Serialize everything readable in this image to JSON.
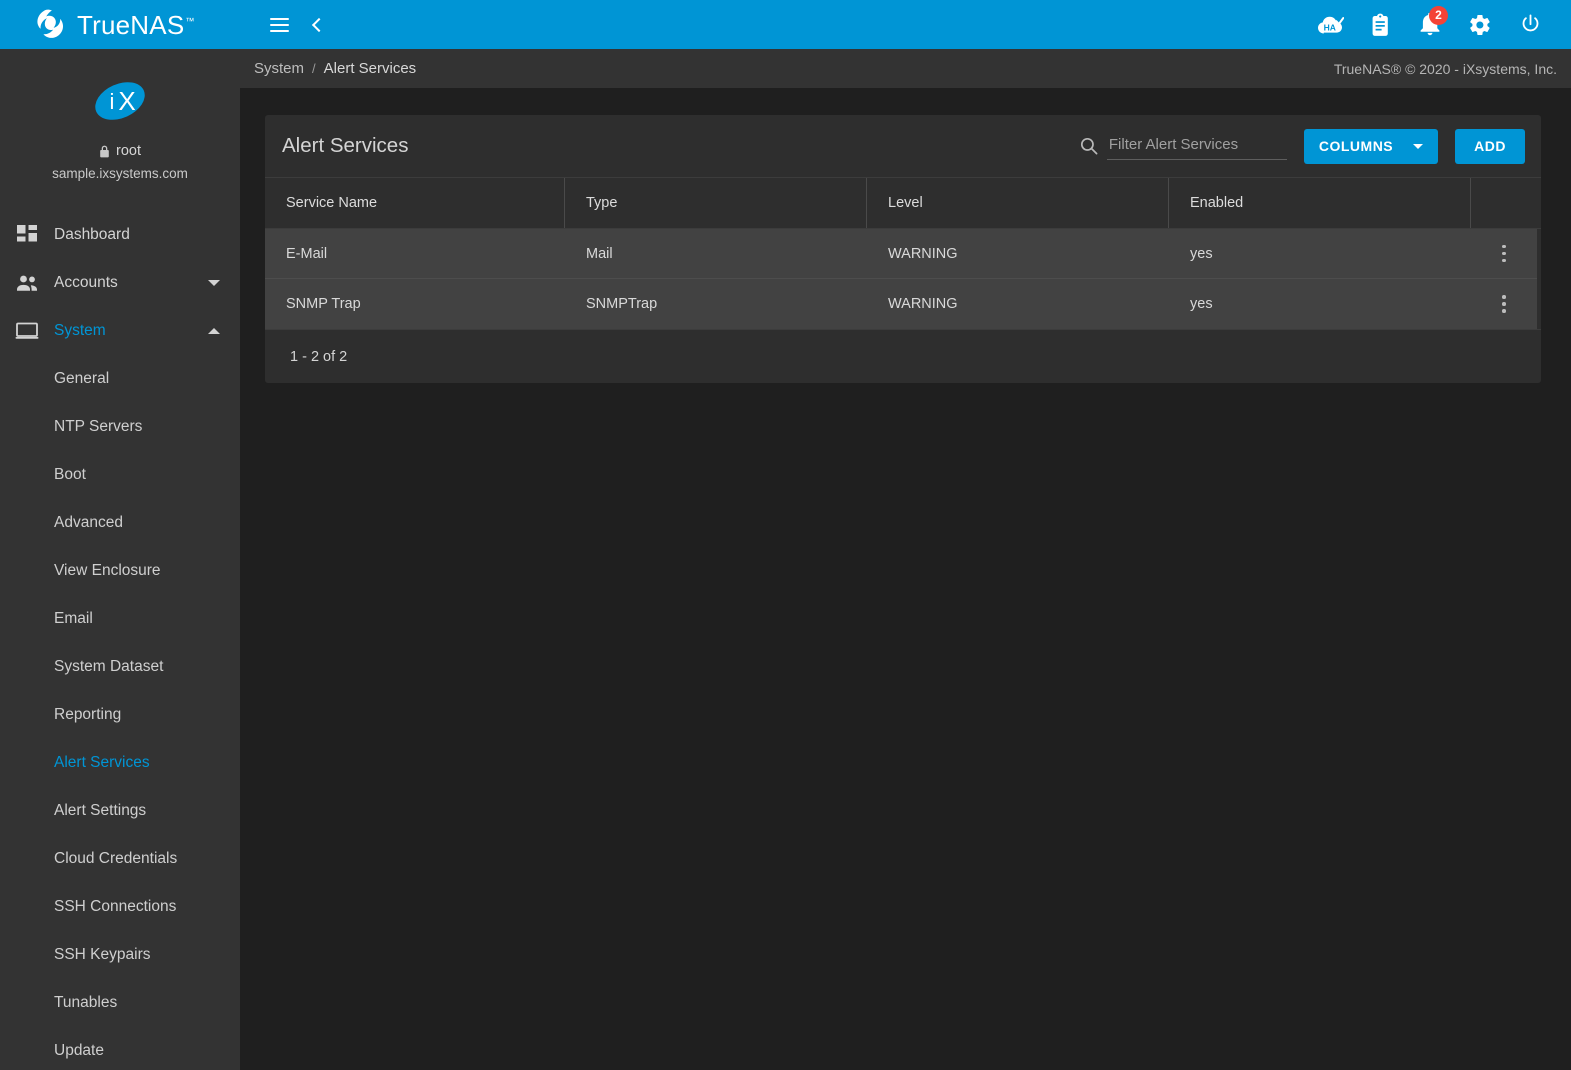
{
  "brand": {
    "name": "TrueNAS",
    "trademark": "™",
    "logo_icon": "truenas-logo-icon"
  },
  "topbar": {
    "menu_icon": "hamburger-menu-icon",
    "back_icon": "chevron-left-icon",
    "icons": [
      {
        "name": "ha-status-icon",
        "label": "HA"
      },
      {
        "name": "clipboard-jobs-icon",
        "label": ""
      },
      {
        "name": "notifications-bell-icon",
        "label": "",
        "badge": "2"
      },
      {
        "name": "settings-gear-icon",
        "label": ""
      },
      {
        "name": "power-icon",
        "label": ""
      }
    ]
  },
  "sidebar": {
    "avatar_icon": "ix-logo-icon",
    "avatar_text": "iX",
    "lock_icon": "lock-icon",
    "username": "root",
    "hostname": "sample.ixsystems.com",
    "items": [
      {
        "label": "Dashboard",
        "icon": "dashboard-grid-icon",
        "expandable": false,
        "active": false
      },
      {
        "label": "Accounts",
        "icon": "accounts-people-icon",
        "expandable": true,
        "expanded": false,
        "active": false
      },
      {
        "label": "System",
        "icon": "system-monitor-icon",
        "expandable": true,
        "expanded": true,
        "active": true
      }
    ],
    "subitems": [
      {
        "label": "General",
        "active": false
      },
      {
        "label": "NTP Servers",
        "active": false
      },
      {
        "label": "Boot",
        "active": false
      },
      {
        "label": "Advanced",
        "active": false
      },
      {
        "label": "View Enclosure",
        "active": false
      },
      {
        "label": "Email",
        "active": false
      },
      {
        "label": "System Dataset",
        "active": false
      },
      {
        "label": "Reporting",
        "active": false
      },
      {
        "label": "Alert Services",
        "active": true
      },
      {
        "label": "Alert Settings",
        "active": false
      },
      {
        "label": "Cloud Credentials",
        "active": false
      },
      {
        "label": "SSH Connections",
        "active": false
      },
      {
        "label": "SSH Keypairs",
        "active": false
      },
      {
        "label": "Tunables",
        "active": false
      },
      {
        "label": "Update",
        "active": false
      }
    ]
  },
  "breadcrumb": {
    "parent": "System",
    "separator": "/",
    "current": "Alert Services"
  },
  "copyright": "TrueNAS® © 2020 - iXsystems, Inc.",
  "card": {
    "title": "Alert Services",
    "search": {
      "icon": "search-icon",
      "placeholder": "Filter Alert Services",
      "value": ""
    },
    "columns_button": "COLUMNS",
    "add_button": "ADD",
    "table": {
      "headers": [
        "Service Name",
        "Type",
        "Level",
        "Enabled",
        ""
      ],
      "rows": [
        {
          "service_name": "E-Mail",
          "type": "Mail",
          "level": "WARNING",
          "enabled": "yes",
          "menu_icon": "kebab-menu-icon"
        },
        {
          "service_name": "SNMP Trap",
          "type": "SNMPTrap",
          "level": "WARNING",
          "enabled": "yes",
          "menu_icon": "kebab-menu-icon"
        }
      ]
    },
    "pagination": "1 - 2 of 2"
  },
  "colors": {
    "accent": "#0095d5",
    "badge": "#f44336",
    "sidebar_bg": "#333333",
    "card_bg": "#2e2e2e",
    "row_bg": "#424242",
    "page_bg": "#1f1f1f"
  }
}
